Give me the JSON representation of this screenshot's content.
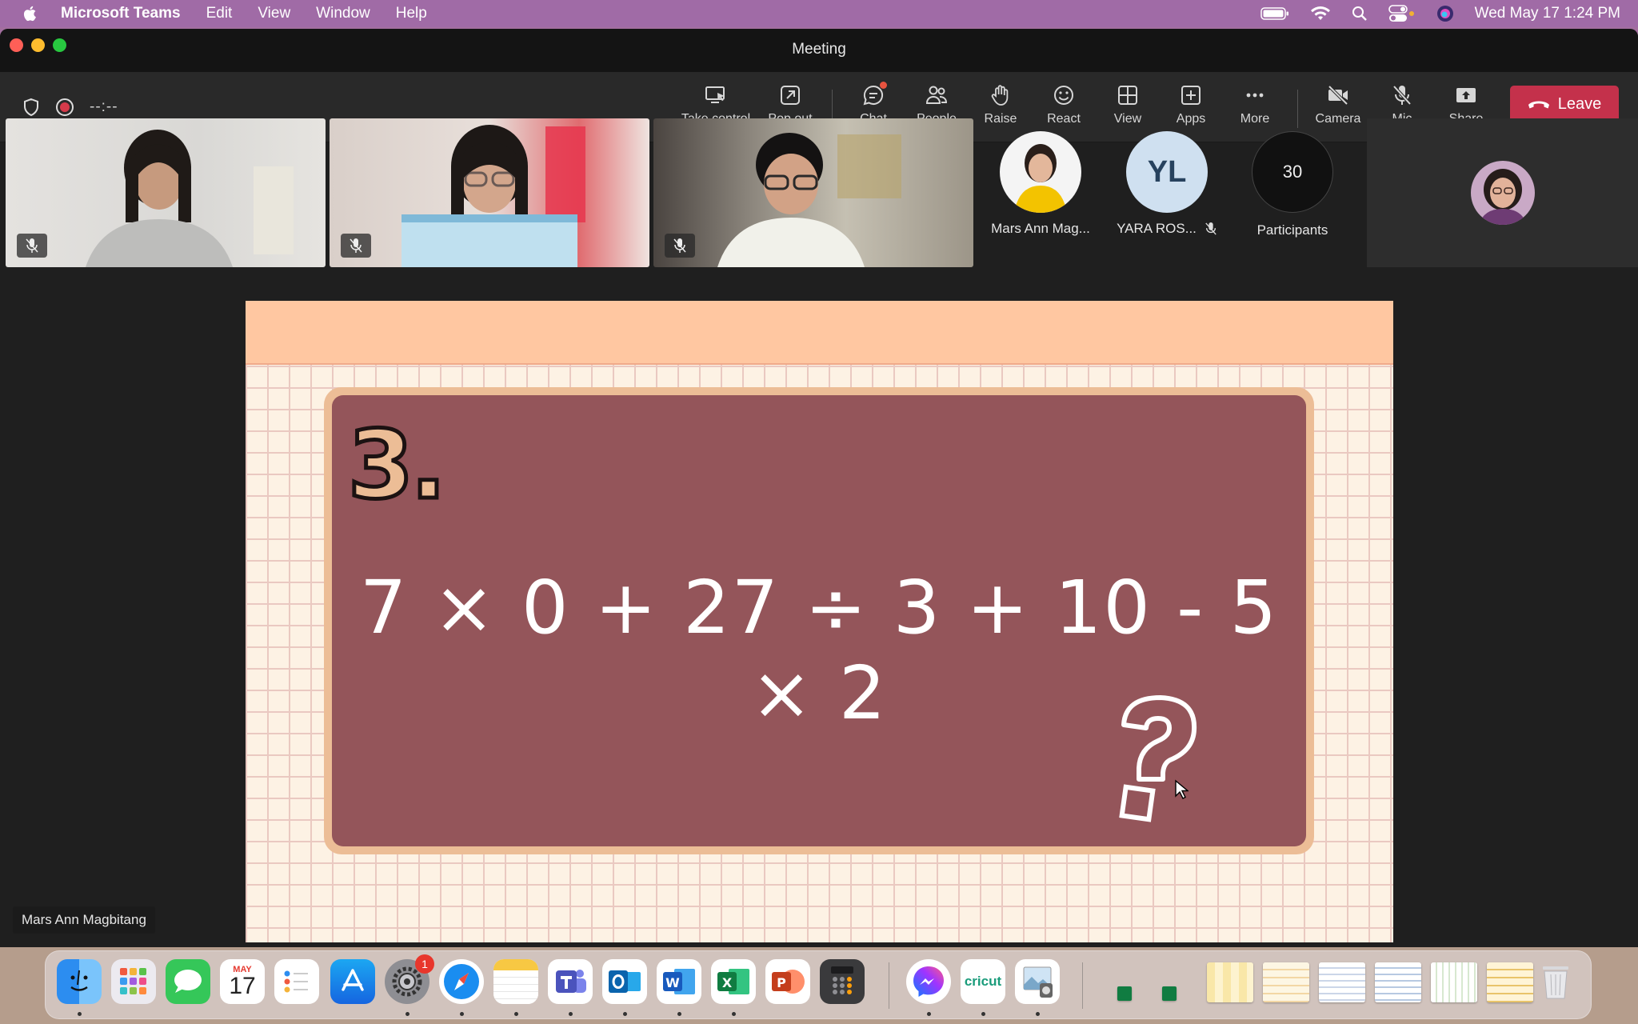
{
  "menubar": {
    "app_name": "Microsoft Teams",
    "items": [
      "Edit",
      "View",
      "Window",
      "Help"
    ],
    "datetime": "Wed May 17  1:24 PM"
  },
  "window": {
    "title": "Meeting"
  },
  "toolbar": {
    "timer": "--:--",
    "buttons": [
      {
        "label": "Take control",
        "icon": "take-control-icon"
      },
      {
        "label": "Pop out",
        "icon": "pop-out-icon"
      },
      {
        "label": "Chat",
        "icon": "chat-icon"
      },
      {
        "label": "People",
        "icon": "people-icon"
      },
      {
        "label": "Raise",
        "icon": "raise-hand-icon"
      },
      {
        "label": "React",
        "icon": "react-icon"
      },
      {
        "label": "View",
        "icon": "view-icon"
      },
      {
        "label": "Apps",
        "icon": "apps-icon"
      },
      {
        "label": "More",
        "icon": "more-icon"
      },
      {
        "label": "Camera",
        "icon": "camera-off-icon"
      },
      {
        "label": "Mic",
        "icon": "mic-off-icon"
      },
      {
        "label": "Share",
        "icon": "share-icon"
      }
    ],
    "leave_label": "Leave",
    "accent": "#c4314b"
  },
  "participants": {
    "avatars": [
      {
        "name": "Mars Ann Mag...",
        "initials": ""
      },
      {
        "name": "YARA ROS...",
        "initials": "YL"
      }
    ],
    "count": "30",
    "count_label": "Participants"
  },
  "slide": {
    "question_number": "3.",
    "equation": "7 × 0 + 27 ÷ 3 + 10 - 5 × 2",
    "board_color": "#94555a",
    "frame_color": "#ecbd96",
    "band_color": "#ffc7a1"
  },
  "presenter_label": "Mars Ann Magbitang",
  "dock": {
    "calendar_month": "MAY",
    "calendar_day": "17",
    "settings_badge": "1",
    "cricut_label": "cricut"
  }
}
